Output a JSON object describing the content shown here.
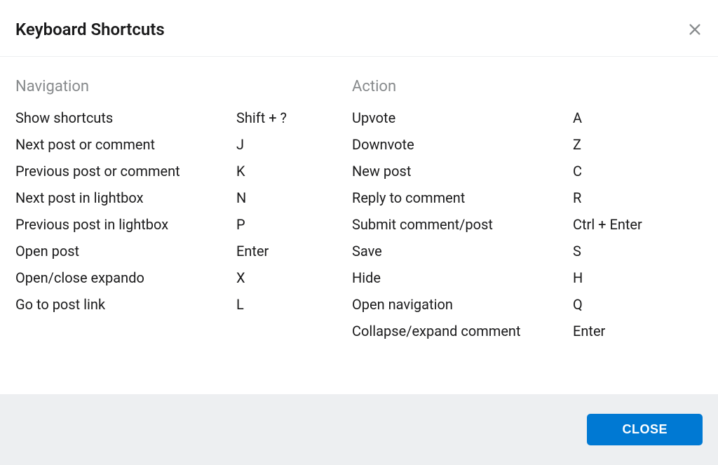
{
  "modal": {
    "title": "Keyboard Shortcuts",
    "close_button_label": "CLOSE"
  },
  "sections": {
    "navigation": {
      "heading": "Navigation",
      "items": [
        {
          "label": "Show shortcuts",
          "key": "Shift + ?"
        },
        {
          "label": "Next post or comment",
          "key": "J"
        },
        {
          "label": "Previous post or comment",
          "key": "K"
        },
        {
          "label": "Next post in lightbox",
          "key": "N"
        },
        {
          "label": "Previous post in lightbox",
          "key": "P"
        },
        {
          "label": "Open post",
          "key": "Enter"
        },
        {
          "label": "Open/close expando",
          "key": "X"
        },
        {
          "label": "Go to post link",
          "key": "L"
        }
      ]
    },
    "action": {
      "heading": "Action",
      "items": [
        {
          "label": "Upvote",
          "key": "A"
        },
        {
          "label": "Downvote",
          "key": "Z"
        },
        {
          "label": "New post",
          "key": "C"
        },
        {
          "label": "Reply to comment",
          "key": "R"
        },
        {
          "label": "Submit comment/post",
          "key": "Ctrl + Enter"
        },
        {
          "label": "Save",
          "key": "S"
        },
        {
          "label": "Hide",
          "key": "H"
        },
        {
          "label": "Open navigation",
          "key": "Q"
        },
        {
          "label": "Collapse/expand comment",
          "key": "Enter"
        }
      ]
    }
  }
}
